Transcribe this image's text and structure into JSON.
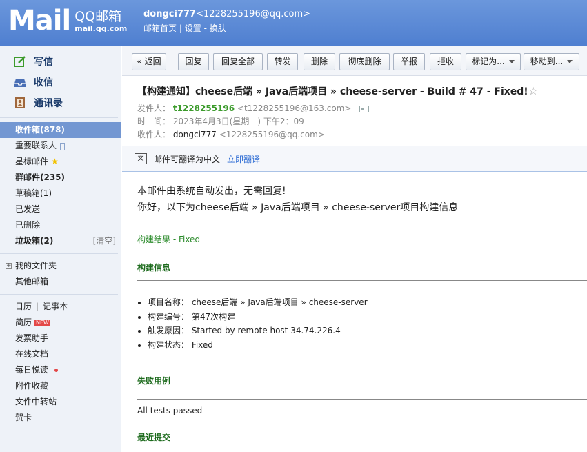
{
  "header": {
    "logo_text": "Mail",
    "logo_cn": "QQ邮箱",
    "logo_url": "mail.qq.com",
    "user_name": "dongci777",
    "user_email": "<1228255196@qq.com>",
    "links": [
      "邮箱首页",
      "|",
      "设置",
      "-",
      "换肤"
    ]
  },
  "sidebar": {
    "actions": [
      {
        "label": "写信",
        "icon": "pencil-icon"
      },
      {
        "label": "收信",
        "icon": "inbox-icon"
      },
      {
        "label": "通讯录",
        "icon": "contacts-icon"
      }
    ],
    "folders": {
      "inbox": "收件箱(878)",
      "important": "重要联系人",
      "starred": "星标邮件",
      "group": "群邮件(235)",
      "drafts": "草稿箱(1)",
      "sent": "已发送",
      "deleted": "已删除",
      "spam": "垃圾箱(2)",
      "spam_clear": "[清空]",
      "my_folders": "我的文件夹",
      "other_mailbox": "其他邮箱"
    },
    "tools": {
      "calendar": "日历",
      "notes": "记事本",
      "resume": "简历",
      "new_badge": "NEW",
      "invoice": "发票助手",
      "online_docs": "在线文档",
      "daily_read": "每日悦读",
      "attachments": "附件收藏",
      "file_transfer": "文件中转站",
      "cards": "贺卡"
    }
  },
  "toolbar": {
    "back": "« 返回",
    "reply": "回复",
    "reply_all": "回复全部",
    "forward": "转发",
    "delete": "删除",
    "delete_permanently": "彻底删除",
    "report": "举报",
    "reject": "拒收",
    "mark_as": "标记为...",
    "move_to": "移动到..."
  },
  "mail": {
    "subject": "【构建通知】cheese后端 » Java后端项目 » cheese-server - Build # 47 - Fixed!",
    "from_label": "发件人：",
    "from_name": "t1228255196",
    "from_email": "<t1228255196@163.com>",
    "time_label": "时　间：",
    "time_value": "2023年4月3日(星期一) 下午2：09",
    "to_label": "收件人：",
    "to_name": "dongci777",
    "to_email": "<1228255196@qq.com>",
    "translate_text": "邮件可翻译为中文",
    "translate_link": "立即翻译"
  },
  "body": {
    "intro1": "本邮件由系统自动发出，无需回复!",
    "intro2": "你好，以下为cheese后端 » Java后端项目 » cheese-server项目构建信息",
    "result": "构建结果 - Fixed",
    "build_info_title": "构建信息",
    "build_info": [
      "项目名称：  cheese后端 » Java后端项目 » cheese-server",
      "构建编号：  第47次构建",
      "触发原因：  Started by remote host 34.74.226.4",
      "构建状态：  Fixed"
    ],
    "failed_title": "失败用例",
    "failed_text": "All tests passed",
    "recent_title": "最近提交"
  }
}
